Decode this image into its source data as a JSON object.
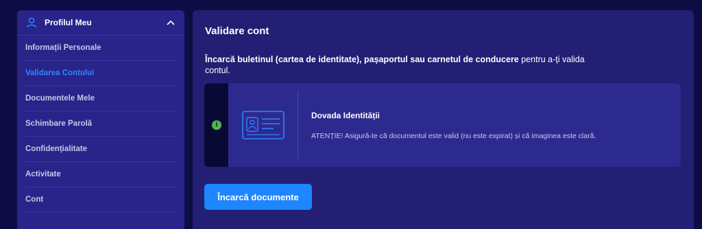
{
  "sidebar": {
    "header": {
      "title": "Profilul Meu",
      "icon": "user-icon"
    },
    "items": [
      {
        "label": "Informații Personale"
      },
      {
        "label": "Validarea Contului"
      },
      {
        "label": "Documentele Mele"
      },
      {
        "label": "Schimbare Parolă"
      },
      {
        "label": "Confidențialitate"
      },
      {
        "label": "Activitate"
      },
      {
        "label": "Cont"
      }
    ],
    "active_label": "Validarea Contului"
  },
  "main": {
    "title": "Validare cont",
    "instructions_bold": "Încarcă buletinul (cartea de identitate), pașaportul sau carnetul de conducere",
    "instructions_light": " pentru a-ți valida contul.",
    "card": {
      "title": "Dovada Identității",
      "text": "ATENȚIE! Asigură-te că documentul este valid (nu este expirat) și că imaginea este clară.",
      "info_icon": "info-icon",
      "info_glyph": "i"
    },
    "upload_button": "Încarcă documente"
  },
  "colors": {
    "background": "#0e0c45",
    "panel": "#221f74",
    "sidebar": "#28248a",
    "accent": "#1e86ff",
    "success": "#4cb848"
  }
}
